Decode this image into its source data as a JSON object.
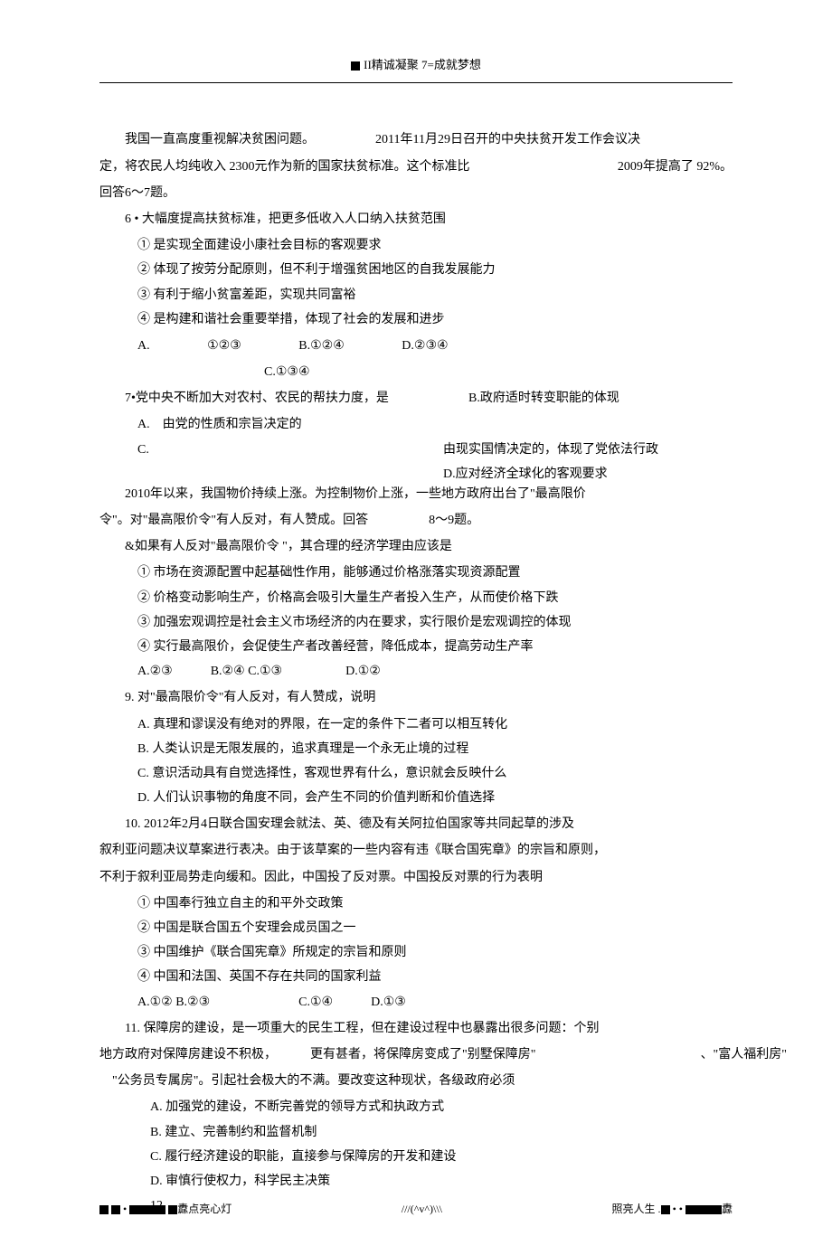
{
  "header": "II精诚凝聚 7=成就梦想",
  "intro": {
    "p1a": "我国一直高度重视解决贫困问题。",
    "p1b": "2011年11月29日召开的中央扶贫开发工作会议决",
    "p2a": "定，将农民人均纯收入 2300元作为新的国家扶贫标准。这个标准比",
    "p2b": "2009年提高了 92%。",
    "p3": "回答6～7题。"
  },
  "q6": {
    "title": "6 • 大幅度提高扶贫标准，把更多低收入人口纳入扶贫范围",
    "o1": "① 是实现全面建设小康社会目标的客观要求",
    "o2": "② 体现了按劳分配原则，但不利于增强贫困地区的自我发展能力",
    "o3": "③ 有利于缩小贫富差距，实现共同富裕",
    "o4": "④ 是构建和谐社会重要举措，体现了社会的发展和进步",
    "ca": "A.",
    "cb": "①②③",
    "cc": "B.①②④",
    "cd": "D.②③④",
    "ce": "C.①③④"
  },
  "q7": {
    "title": "7•党中央不断加大对农村、农民的帮扶力度，是",
    "ra": "B.政府适时转变职能的体现",
    "a": "A.　由党的性质和宗旨决定的",
    "c": "C.",
    "rc": "由现实国情决定的，体现了党依法行政",
    "rd": "D.应对经济全球化的客观要求"
  },
  "intro2": {
    "p1": "2010年以来，我国物价持续上涨。为控制物价上涨，一些地方政府出台了\"最高限价",
    "p2a": "令\"。对\"最高限价令\"有人反对，有人赞成。回答",
    "p2b": "8～9题。"
  },
  "q8": {
    "title": "&如果有人反对\"最高限价令 \"，其合理的经济学理由应该是",
    "o1": "① 市场在资源配置中起基础性作用，能够通过价格涨落实现资源配置",
    "o2": "② 价格变动影响生产，价格高会吸引大量生产者投入生产，从而使价格下跌",
    "o3": "③ 加强宏观调控是社会主义市场经济的内在要求，实行限价是宏观调控的体现",
    "o4": "④ 实行最高限价，会促使生产者改善经营，降低成本，提高劳动生产率",
    "choices": "A.②③　　　B.②④ C.①③　　　　　D.①②"
  },
  "q9": {
    "title": "9. 对\"最高限价令\"有人反对，有人赞成，说明",
    "a": "A. 真理和谬误没有绝对的界限，在一定的条件下二者可以相互转化",
    "b": "B. 人类认识是无限发展的，追求真理是一个永无止境的过程",
    "c": "C. 意识活动具有自觉选择性，客观世界有什么，意识就会反映什么",
    "d": "D. 人们认识事物的角度不同，会产生不同的价值判断和价值选择"
  },
  "q10": {
    "title": "10. 2012年2月4日联合国安理会就法、英、德及有关阿拉伯国家等共同起草的涉及",
    "p1": "叙利亚问题决议草案进行表决。由于该草案的一些内容有违《联合国宪章》的宗旨和原则，",
    "p2": "不利于叙利亚局势走向缓和。因此，中国投了反对票。中国投反对票的行为表明",
    "o1": "① 中国奉行独立自主的和平外交政策",
    "o2": "② 中国是联合国五个安理会成员国之一",
    "o3": "③ 中国维护《联合国宪章》所规定的宗旨和原则",
    "o4": "④ 中国和法国、英国不存在共同的国家利益",
    "choices": "A.①② B.②③　　　　　　　C.①④　　　D.①③"
  },
  "q11": {
    "title": "11. 保障房的建设，是一项重大的民生工程，但在建设过程中也暴露出很多问题：个别",
    "p1a": "地方政府对保障房建设不积极，",
    "p1b": "更有甚者，将保障房变成了\"别墅保障房\"",
    "p1c": "、\"富人福利房\"",
    "p2": "\"公务员专属房\"。引起社会极大的不满。要改变这种现状，各级政府必须",
    "a": "A. 加强党的建设，不断完善党的领导方式和执政方式",
    "b": "B. 建立、完善制约和监督机制",
    "c": "C. 履行经济建设的职能，直接参与保障房的开发和建设",
    "d": "D. 审慎行使权力，科学民主决策"
  },
  "q12": "12.",
  "footer": {
    "left": "纛点亮心灯",
    "center": "///(^v^)\\\\\\",
    "right": "照亮人生 ."
  }
}
